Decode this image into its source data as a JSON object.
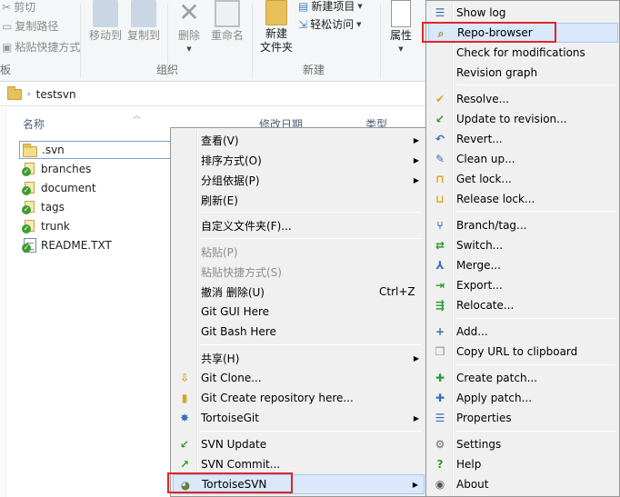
{
  "ribbon": {
    "cut": "剪切",
    "copy_path": "复制路径",
    "paste_shortcut": "粘贴快捷方式",
    "clipboard_group": "板",
    "move_to": "移动到",
    "copy_to": "复制到",
    "delete": "删除",
    "rename": "重命名",
    "organize_group": "组织",
    "new_folder_line1": "新建",
    "new_folder_line2": "文件夹",
    "new_item": "新建项目",
    "easy_access": "轻松访问",
    "new_group": "新建",
    "properties": "属性"
  },
  "address": {
    "path": "testsvn"
  },
  "file_list": {
    "col_name": "名称",
    "col_modified": "修改日期",
    "col_type": "类型",
    "files": [
      {
        "name": ".svn",
        "icon": "folder-icon"
      },
      {
        "name": "branches",
        "icon": "svn-folder-icon"
      },
      {
        "name": "document",
        "icon": "svn-folder-icon"
      },
      {
        "name": "tags",
        "icon": "svn-folder-icon"
      },
      {
        "name": "trunk",
        "icon": "svn-folder-icon"
      },
      {
        "name": "README.TXT",
        "icon": "text-file-icon"
      }
    ]
  },
  "context_menu": {
    "items": [
      {
        "label": "查看(V)"
      },
      {
        "label": "排序方式(O)"
      },
      {
        "label": "分组依据(P)"
      },
      {
        "label": "刷新(E)"
      },
      {
        "label": "自定义文件夹(F)..."
      },
      {
        "label": "粘贴(P)"
      },
      {
        "label": "粘贴快捷方式(S)"
      },
      {
        "label": "撤消 删除(U)",
        "shortcut": "Ctrl+Z"
      },
      {
        "label": "Git GUI Here"
      },
      {
        "label": "Git Bash Here"
      },
      {
        "label": "共享(H)"
      },
      {
        "label": "Git Clone..."
      },
      {
        "label": "Git Create repository here..."
      },
      {
        "label": "TortoiseGit"
      },
      {
        "label": "SVN Update"
      },
      {
        "label": "SVN Commit..."
      },
      {
        "label": "TortoiseSVN"
      }
    ]
  },
  "svn_submenu": {
    "items": [
      {
        "label": "Show log"
      },
      {
        "label": "Repo-browser"
      },
      {
        "label": "Check for modifications"
      },
      {
        "label": "Revision graph"
      },
      {
        "label": "Resolve..."
      },
      {
        "label": "Update to revision..."
      },
      {
        "label": "Revert..."
      },
      {
        "label": "Clean up..."
      },
      {
        "label": "Get lock..."
      },
      {
        "label": "Release lock..."
      },
      {
        "label": "Branch/tag..."
      },
      {
        "label": "Switch..."
      },
      {
        "label": "Merge..."
      },
      {
        "label": "Export..."
      },
      {
        "label": "Relocate..."
      },
      {
        "label": "Add..."
      },
      {
        "label": "Copy URL to clipboard"
      },
      {
        "label": "Create patch..."
      },
      {
        "label": "Apply patch..."
      },
      {
        "label": "Properties"
      },
      {
        "label": "Settings"
      },
      {
        "label": "Help"
      },
      {
        "label": "About"
      }
    ]
  },
  "colors": {
    "highlight_box": "#e02626",
    "menu_bg": "#f0f0f0",
    "hover_bg": "#d9e8fb"
  }
}
